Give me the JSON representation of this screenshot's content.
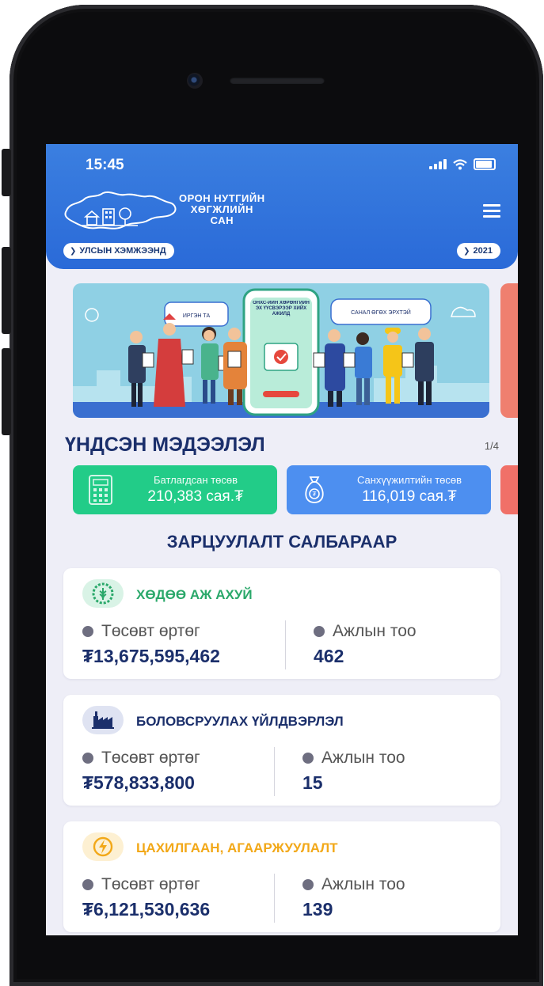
{
  "status_bar": {
    "time": "15:45"
  },
  "header": {
    "brand_line1": "ОРОН НУТГИЙН",
    "brand_line2": "ХӨГЖЛИЙН",
    "brand_line3": "САН",
    "scope_selector": "УЛСЫН ХЭМЖЭЭНД",
    "year_selector": "2021"
  },
  "banner": {
    "bubble_left": "ИРГЭН ТА",
    "bubble_center": "ОНХС-ИЙН ХӨРӨНГИЙН ЭХ ҮҮСВЭРЭЭР ХИЙХ АЖИЛД",
    "bubble_right": "САНАЛ ӨГӨХ ЭРХТЭЙ"
  },
  "basic_info": {
    "title": "ҮНДСЭН МЭДЭЭЛЭЛ",
    "pager": "1/4",
    "cards": [
      {
        "label": "Батлагдсан төсөв",
        "value": "210,383 сая.₮",
        "color": "#22cc88"
      },
      {
        "label": "Санхүүжилтийн төсөв",
        "value": "116,019 сая.₮",
        "color": "#4d8ff0"
      }
    ]
  },
  "spending": {
    "title": "ЗАРЦУУЛАЛТ САЛБАРААР",
    "budget_label": "Төсөвт өртөг",
    "count_label": "Ажлын тоо",
    "sectors": [
      {
        "name": "ХӨДӨӨ АЖ АХУЙ",
        "budget": "₮13,675,595,462",
        "count": "462",
        "color": "#2aa86a",
        "icon": "agriculture-icon"
      },
      {
        "name": "БОЛОВСРУУЛАХ ҮЙЛДВЭРЛЭЛ",
        "budget": "₮578,833,800",
        "count": "15",
        "color": "#1b2f6b",
        "icon": "factory-icon"
      },
      {
        "name": "ЦАХИЛГААН, АГААРЖУУЛАЛТ",
        "budget": "₮6,121,530,636",
        "count": "139",
        "color": "#f2a818",
        "icon": "lightning-icon"
      }
    ]
  }
}
